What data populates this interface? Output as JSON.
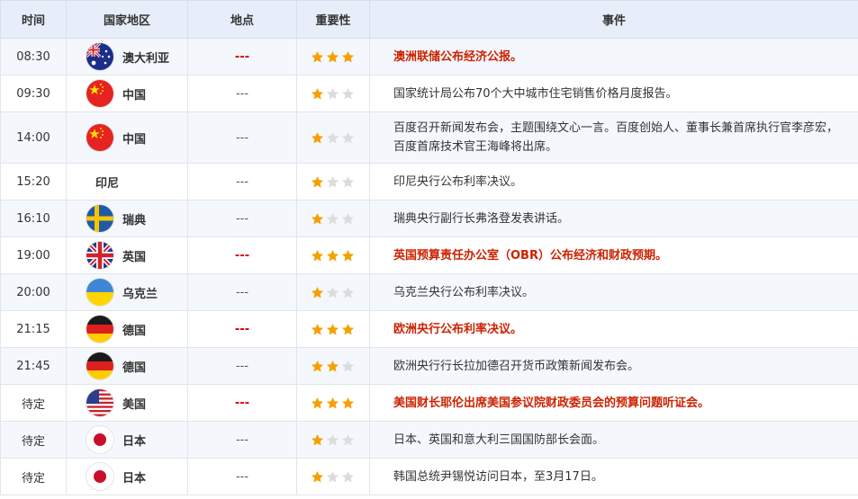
{
  "headers": {
    "time": "时间",
    "country": "国家地区",
    "place": "地点",
    "importance": "重要性",
    "event": "事件"
  },
  "colors": {
    "high_text": "#cc2200",
    "star_on": "#f5a000",
    "star_off": "#dcdcdc",
    "header_bg": "#e8eef9"
  },
  "rows": [
    {
      "time": "08:30",
      "country": "澳大利亚",
      "flag": "australia-flag-icon",
      "place": "---",
      "stars": 3,
      "event": "澳洲联储公布经济公报。",
      "high": true
    },
    {
      "time": "09:30",
      "country": "中国",
      "flag": "china-flag-icon",
      "place": "---",
      "stars": 1,
      "event": "国家统计局公布70个大中城市住宅销售价格月度报告。",
      "high": false
    },
    {
      "time": "14:00",
      "country": "中国",
      "flag": "china-flag-icon",
      "place": "---",
      "stars": 1,
      "event": "百度召开新闻发布会，主题围绕文心一言。百度创始人、董事长兼首席执行官李彦宏，百度首席技术官王海峰将出席。",
      "high": false
    },
    {
      "time": "15:20",
      "country": "印尼",
      "flag": "",
      "place": "---",
      "stars": 1,
      "event": "印尼央行公布利率决议。",
      "high": false
    },
    {
      "time": "16:10",
      "country": "瑞典",
      "flag": "sweden-flag-icon",
      "place": "---",
      "stars": 1,
      "event": "瑞典央行副行长弗洛登发表讲话。",
      "high": false
    },
    {
      "time": "19:00",
      "country": "英国",
      "flag": "uk-flag-icon",
      "place": "---",
      "stars": 3,
      "event": "英国预算责任办公室（OBR）公布经济和财政预期。",
      "high": true
    },
    {
      "time": "20:00",
      "country": "乌克兰",
      "flag": "ukraine-flag-icon",
      "place": "---",
      "stars": 1,
      "event": "乌克兰央行公布利率决议。",
      "high": false
    },
    {
      "time": "21:15",
      "country": "德国",
      "flag": "germany-flag-icon",
      "place": "---",
      "stars": 3,
      "event": "欧洲央行公布利率决议。",
      "high": true
    },
    {
      "time": "21:45",
      "country": "德国",
      "flag": "germany-flag-icon",
      "place": "---",
      "stars": 2,
      "event": "欧洲央行行长拉加德召开货币政策新闻发布会。",
      "high": false
    },
    {
      "time": "待定",
      "country": "美国",
      "flag": "usa-flag-icon",
      "place": "---",
      "stars": 3,
      "event": "美国财长耶伦出席美国参议院财政委员会的预算问题听证会。",
      "high": true
    },
    {
      "time": "待定",
      "country": "日本",
      "flag": "japan-flag-icon",
      "place": "---",
      "stars": 1,
      "event": "日本、英国和意大利三国国防部长会面。",
      "high": false
    },
    {
      "time": "待定",
      "country": "日本",
      "flag": "japan-flag-icon",
      "place": "---",
      "stars": 1,
      "event": "韩国总统尹锡悦访问日本，至3月17日。",
      "high": false
    }
  ]
}
